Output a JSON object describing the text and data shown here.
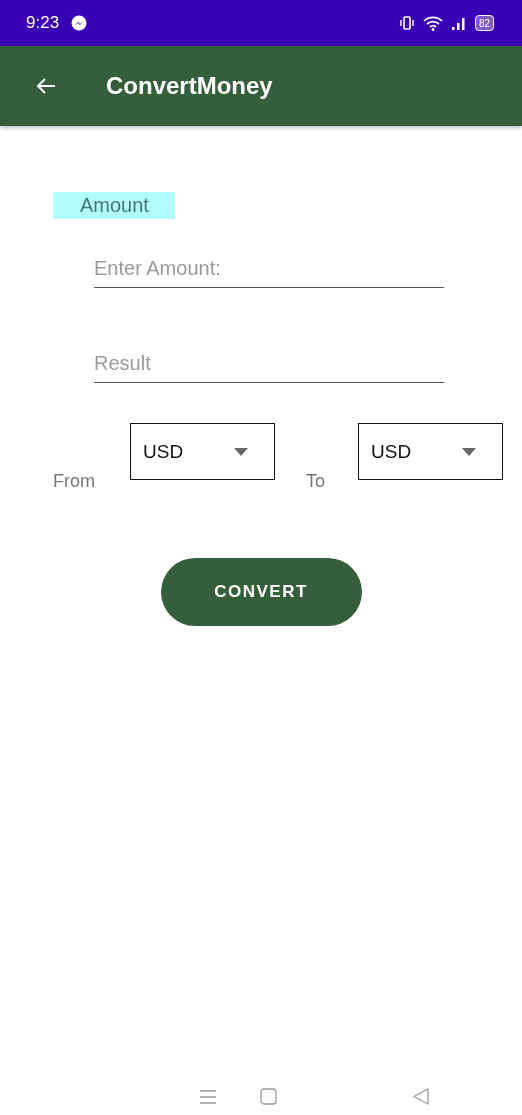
{
  "status_bar": {
    "time": "9:23",
    "battery": "82"
  },
  "app_bar": {
    "title": "ConvertMoney"
  },
  "amount_label": "Amount",
  "amount_field": {
    "placeholder": "Enter Amount:"
  },
  "result_field": {
    "placeholder": "Result"
  },
  "from": {
    "label": "From",
    "value": "USD"
  },
  "to": {
    "label": "To",
    "value": "USD"
  },
  "convert_button": "CONVERT"
}
